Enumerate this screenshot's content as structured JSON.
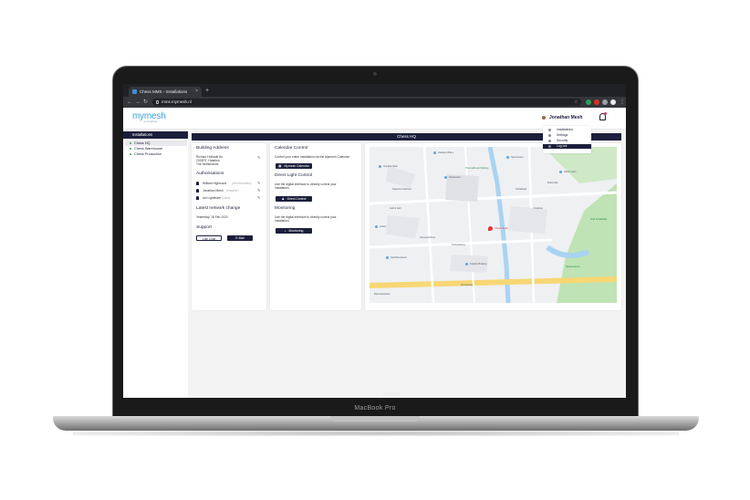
{
  "device": {
    "brand_label": "MacBook Pro"
  },
  "browser": {
    "tab_title": "Chess MMS - Installations",
    "url": "mms.mymesh.nl",
    "new_tab_symbol": "+",
    "close_symbol": "×"
  },
  "header": {
    "logo": "mymesh",
    "logo_sub": "mesh lighting",
    "user_name": "Jonathan Mesh"
  },
  "user_menu": {
    "items": [
      "Installations",
      "Settings",
      "Security",
      "Log out"
    ]
  },
  "sidebar": {
    "title": "Installations",
    "items": [
      "Chess HQ",
      "Chess Warehouse",
      "Chess Production"
    ]
  },
  "page": {
    "title": "Chess HQ"
  },
  "info_card": {
    "building_title": "Building Address",
    "address_lines": [
      "Richard Holkade 8u",
      "2033PZ, Haarlem",
      "The Netherlands"
    ],
    "auth_title": "Authorisations",
    "authorisations": [
      {
        "name": "William Highwood",
        "role": "(Administrator)"
      },
      {
        "name": "Jonathan Mesh",
        "role": "(Installer)"
      },
      {
        "name": "Ian Lightbuter",
        "role": "(User)"
      }
    ],
    "network_title": "Latest network change",
    "network_value": "Yesterday, 18 Feb 2020",
    "support_title": "Support",
    "live_chat": "Live Chat",
    "email": "E-Mail"
  },
  "control_card": {
    "calendar_title": "Calendar Control",
    "calendar_text": "Control your entire installation via the Mymesh Calendar",
    "calendar_btn": "Mymesh Calendar",
    "direct_title": "Direct Light Control",
    "direct_text": "Use the digital interface to directly control your installation.",
    "direct_btn": "Direct Control",
    "monitor_title": "Monitoring",
    "monitor_text": "Use the digital interface to directly control your installation.",
    "monitor_btn": "Monitoring"
  },
  "map": {
    "pin_label": "Chess Order",
    "labels": [
      "Haarlem Bikes",
      "Specsavers",
      "Inspired Nails",
      "ThermaSmart Parking",
      "Spaarne Gasthuis",
      "Schalkwijk",
      "Dekamarkt",
      "Albert Heijn",
      "Kruidvat",
      "Gall & Gall",
      "Action",
      "Gemeentehuis",
      "Zuid Schalkwijk",
      "Slachthuisbuurt",
      "Europaweg",
      "Dolphin Bowling",
      "Schouwburg",
      "Sportcentrum",
      "Molenwijk",
      "Boerhaavelaan"
    ],
    "colors": {
      "water": "#a9d3f2",
      "park": "#bfe3b4",
      "road": "#f7d774"
    }
  },
  "watermark": "MyMesh"
}
